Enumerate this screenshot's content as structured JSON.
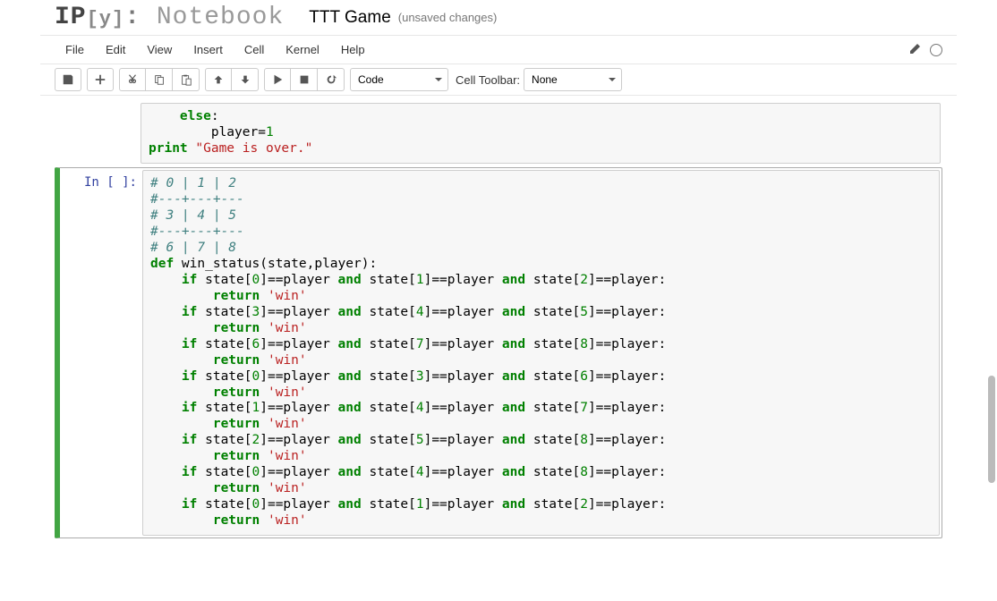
{
  "header": {
    "logo_ip": "IP",
    "logo_y": "[y]",
    "logo_colon": ":",
    "logo_nb": " Notebook",
    "notebook_name": "TTT Game",
    "save_status": "(unsaved changes)"
  },
  "menu": {
    "file": "File",
    "edit": "Edit",
    "view": "View",
    "insert": "Insert",
    "cell": "Cell",
    "kernel": "Kernel",
    "help": "Help"
  },
  "toolbar": {
    "cell_type": "Code",
    "cell_toolbar_label": "Cell Toolbar:",
    "cell_toolbar": "None"
  },
  "cells": {
    "partial": {
      "lines": [
        {
          "t": "kw",
          "s": "    else"
        },
        {
          "t": "p",
          "s": ":\n"
        },
        {
          "t": "p",
          "s": "        player="
        },
        {
          "t": "num",
          "s": "1"
        },
        {
          "t": "p",
          "s": "\n"
        },
        {
          "t": "p",
          "s": "\n"
        },
        {
          "t": "kw",
          "s": "print"
        },
        {
          "t": "p",
          "s": " "
        },
        {
          "t": "str",
          "s": "\"Game is over.\""
        }
      ]
    },
    "main": {
      "prompt": "In [ ]:",
      "code": [
        [
          {
            "t": "cm",
            "s": "# 0 | 1 | 2"
          }
        ],
        [
          {
            "t": "cm",
            "s": "#---+---+---"
          }
        ],
        [
          {
            "t": "cm",
            "s": "# 3 | 4 | 5"
          }
        ],
        [
          {
            "t": "cm",
            "s": "#---+---+---"
          }
        ],
        [
          {
            "t": "cm",
            "s": "# 6 | 7 | 8"
          }
        ],
        [
          {
            "t": "p",
            "s": ""
          }
        ],
        [
          {
            "t": "kw",
            "s": "def"
          },
          {
            "t": "p",
            "s": " win_status(state,player):"
          }
        ],
        [
          {
            "t": "p",
            "s": "    "
          },
          {
            "t": "kw",
            "s": "if"
          },
          {
            "t": "p",
            "s": " state["
          },
          {
            "t": "num",
            "s": "0"
          },
          {
            "t": "p",
            "s": "]==player "
          },
          {
            "t": "kw2",
            "s": "and"
          },
          {
            "t": "p",
            "s": " state["
          },
          {
            "t": "num",
            "s": "1"
          },
          {
            "t": "p",
            "s": "]==player "
          },
          {
            "t": "kw2",
            "s": "and"
          },
          {
            "t": "p",
            "s": " state["
          },
          {
            "t": "num",
            "s": "2"
          },
          {
            "t": "p",
            "s": "]==player:"
          }
        ],
        [
          {
            "t": "p",
            "s": "        "
          },
          {
            "t": "kw",
            "s": "return"
          },
          {
            "t": "p",
            "s": " "
          },
          {
            "t": "str",
            "s": "'win'"
          }
        ],
        [
          {
            "t": "p",
            "s": "    "
          },
          {
            "t": "kw",
            "s": "if"
          },
          {
            "t": "p",
            "s": " state["
          },
          {
            "t": "num",
            "s": "3"
          },
          {
            "t": "p",
            "s": "]==player "
          },
          {
            "t": "kw2",
            "s": "and"
          },
          {
            "t": "p",
            "s": " state["
          },
          {
            "t": "num",
            "s": "4"
          },
          {
            "t": "p",
            "s": "]==player "
          },
          {
            "t": "kw2",
            "s": "and"
          },
          {
            "t": "p",
            "s": " state["
          },
          {
            "t": "num",
            "s": "5"
          },
          {
            "t": "p",
            "s": "]==player:"
          }
        ],
        [
          {
            "t": "p",
            "s": "        "
          },
          {
            "t": "kw",
            "s": "return"
          },
          {
            "t": "p",
            "s": " "
          },
          {
            "t": "str",
            "s": "'win'"
          }
        ],
        [
          {
            "t": "p",
            "s": "    "
          },
          {
            "t": "kw",
            "s": "if"
          },
          {
            "t": "p",
            "s": " state["
          },
          {
            "t": "num",
            "s": "6"
          },
          {
            "t": "p",
            "s": "]==player "
          },
          {
            "t": "kw2",
            "s": "and"
          },
          {
            "t": "p",
            "s": " state["
          },
          {
            "t": "num",
            "s": "7"
          },
          {
            "t": "p",
            "s": "]==player "
          },
          {
            "t": "kw2",
            "s": "and"
          },
          {
            "t": "p",
            "s": " state["
          },
          {
            "t": "num",
            "s": "8"
          },
          {
            "t": "p",
            "s": "]==player:"
          }
        ],
        [
          {
            "t": "p",
            "s": "        "
          },
          {
            "t": "kw",
            "s": "return"
          },
          {
            "t": "p",
            "s": " "
          },
          {
            "t": "str",
            "s": "'win'"
          }
        ],
        [
          {
            "t": "p",
            "s": "    "
          },
          {
            "t": "kw",
            "s": "if"
          },
          {
            "t": "p",
            "s": " state["
          },
          {
            "t": "num",
            "s": "0"
          },
          {
            "t": "p",
            "s": "]==player "
          },
          {
            "t": "kw2",
            "s": "and"
          },
          {
            "t": "p",
            "s": " state["
          },
          {
            "t": "num",
            "s": "3"
          },
          {
            "t": "p",
            "s": "]==player "
          },
          {
            "t": "kw2",
            "s": "and"
          },
          {
            "t": "p",
            "s": " state["
          },
          {
            "t": "num",
            "s": "6"
          },
          {
            "t": "p",
            "s": "]==player:"
          }
        ],
        [
          {
            "t": "p",
            "s": "        "
          },
          {
            "t": "kw",
            "s": "return"
          },
          {
            "t": "p",
            "s": " "
          },
          {
            "t": "str",
            "s": "'win'"
          }
        ],
        [
          {
            "t": "p",
            "s": "    "
          },
          {
            "t": "kw",
            "s": "if"
          },
          {
            "t": "p",
            "s": " state["
          },
          {
            "t": "num",
            "s": "1"
          },
          {
            "t": "p",
            "s": "]==player "
          },
          {
            "t": "kw2",
            "s": "and"
          },
          {
            "t": "p",
            "s": " state["
          },
          {
            "t": "num",
            "s": "4"
          },
          {
            "t": "p",
            "s": "]==player "
          },
          {
            "t": "kw2",
            "s": "and"
          },
          {
            "t": "p",
            "s": " state["
          },
          {
            "t": "num",
            "s": "7"
          },
          {
            "t": "p",
            "s": "]==player:"
          }
        ],
        [
          {
            "t": "p",
            "s": "        "
          },
          {
            "t": "kw",
            "s": "return"
          },
          {
            "t": "p",
            "s": " "
          },
          {
            "t": "str",
            "s": "'win'"
          }
        ],
        [
          {
            "t": "p",
            "s": "    "
          },
          {
            "t": "kw",
            "s": "if"
          },
          {
            "t": "p",
            "s": " state["
          },
          {
            "t": "num",
            "s": "2"
          },
          {
            "t": "p",
            "s": "]==player "
          },
          {
            "t": "kw2",
            "s": "and"
          },
          {
            "t": "p",
            "s": " state["
          },
          {
            "t": "num",
            "s": "5"
          },
          {
            "t": "p",
            "s": "]==player "
          },
          {
            "t": "kw2",
            "s": "and"
          },
          {
            "t": "p",
            "s": " state["
          },
          {
            "t": "num",
            "s": "8"
          },
          {
            "t": "p",
            "s": "]==player:"
          }
        ],
        [
          {
            "t": "p",
            "s": "        "
          },
          {
            "t": "kw",
            "s": "return"
          },
          {
            "t": "p",
            "s": " "
          },
          {
            "t": "str",
            "s": "'win'"
          }
        ],
        [
          {
            "t": "p",
            "s": "    "
          },
          {
            "t": "kw",
            "s": "if"
          },
          {
            "t": "p",
            "s": " state["
          },
          {
            "t": "num",
            "s": "0"
          },
          {
            "t": "p",
            "s": "]==player "
          },
          {
            "t": "kw2",
            "s": "and"
          },
          {
            "t": "p",
            "s": " state["
          },
          {
            "t": "num",
            "s": "4"
          },
          {
            "t": "p",
            "s": "]==player "
          },
          {
            "t": "kw2",
            "s": "and"
          },
          {
            "t": "p",
            "s": " state["
          },
          {
            "t": "num",
            "s": "8"
          },
          {
            "t": "p",
            "s": "]==player:"
          }
        ],
        [
          {
            "t": "p",
            "s": "        "
          },
          {
            "t": "kw",
            "s": "return"
          },
          {
            "t": "p",
            "s": " "
          },
          {
            "t": "str",
            "s": "'win'"
          }
        ],
        [
          {
            "t": "p",
            "s": "    "
          },
          {
            "t": "kw",
            "s": "if"
          },
          {
            "t": "p",
            "s": " state["
          },
          {
            "t": "num",
            "s": "0"
          },
          {
            "t": "p",
            "s": "]==player "
          },
          {
            "t": "kw2",
            "s": "and"
          },
          {
            "t": "p",
            "s": " state["
          },
          {
            "t": "num",
            "s": "1"
          },
          {
            "t": "p",
            "s": "]==player "
          },
          {
            "t": "kw2",
            "s": "and"
          },
          {
            "t": "p",
            "s": " state["
          },
          {
            "t": "num",
            "s": "2"
          },
          {
            "t": "p",
            "s": "]==player:"
          }
        ],
        [
          {
            "t": "p",
            "s": "        "
          },
          {
            "t": "kw",
            "s": "return"
          },
          {
            "t": "p",
            "s": " "
          },
          {
            "t": "str",
            "s": "'win'"
          }
        ]
      ]
    }
  }
}
